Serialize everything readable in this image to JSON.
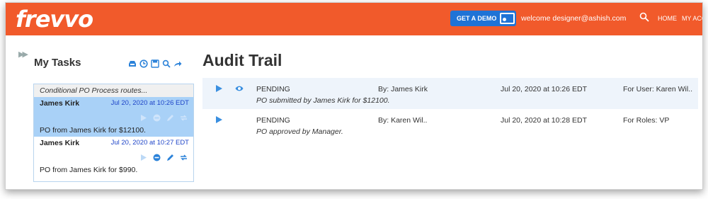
{
  "header": {
    "logo_text": "frevvo",
    "demo_button_label": "GET A DEMO",
    "welcome_text": "welcome designer@ashish.com",
    "nav_home": "HOME",
    "nav_account": "MY ACCO",
    "brand_color": "#f15a2b",
    "demo_color": "#1f73d6"
  },
  "sidebar": {
    "title": "My Tasks",
    "tools": [
      "inbox-icon",
      "history-icon",
      "save-icon",
      "search-icon",
      "share-icon"
    ],
    "group_label": "Conditional PO Process routes...",
    "tasks": [
      {
        "name": "James Kirk",
        "date": "Jul 20, 2020 at 10:26 EDT",
        "desc": "PO from James Kirk for $12100.",
        "selected": true
      },
      {
        "name": "James Kirk",
        "date": "Jul 20, 2020 at 10:27 EDT",
        "desc": "PO from James Kirk for $990.",
        "selected": false
      }
    ]
  },
  "main": {
    "title": "Audit Trail",
    "rows": [
      {
        "status": "PENDING",
        "by": "By: James Kirk",
        "when": "Jul 20, 2020 at 10:26 EDT",
        "for": "For User: Karen Wil..",
        "comment": "PO submitted by James Kirk for $12100."
      },
      {
        "status": "PENDING",
        "by": "By: Karen Wil..",
        "when": "Jul 20, 2020 at 10:28 EDT",
        "for": "For Roles: VP",
        "comment": "PO approved by Manager."
      }
    ]
  }
}
